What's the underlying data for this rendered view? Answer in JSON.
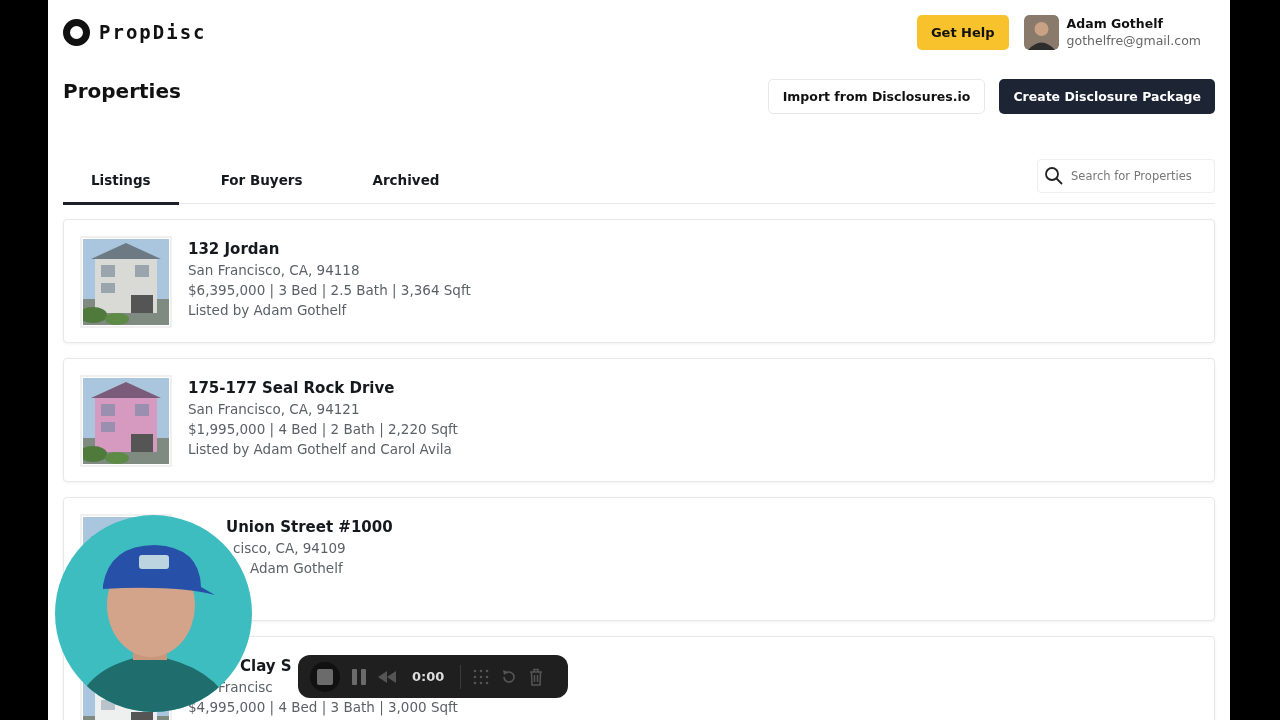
{
  "brand": {
    "name": "PropDisc"
  },
  "header": {
    "help_button": "Get Help",
    "user": {
      "name": "Adam Gothelf",
      "email": "gothelfre@gmail.com"
    }
  },
  "page": {
    "title": "Properties",
    "actions": [
      {
        "label": "Import from Disclosures.io",
        "kind": "outline"
      },
      {
        "label": "Create Disclosure Package",
        "kind": "solid"
      }
    ]
  },
  "tabs": [
    {
      "label": "Listings",
      "selected": true
    },
    {
      "label": "For Buyers",
      "selected": false
    },
    {
      "label": "Archived",
      "selected": false
    }
  ],
  "search": {
    "placeholder": "Search for Properties"
  },
  "listings": [
    {
      "kind": "full",
      "title": "132 Jordan",
      "address": "San Francisco, CA, 94118",
      "details": "$6,395,000 | 3 Bed | 2.5 Bath | 3,364 Sqft",
      "listed_by": "Listed by Adam Gothelf"
    },
    {
      "kind": "full",
      "title": "175-177 Seal Rock Drive",
      "address": "San Francisco, CA, 94121",
      "details": "$1,995,000 | 4 Bed | 2 Bath | 2,220 Sqft",
      "listed_by": "Listed by Adam Gothelf and Carol Avila"
    },
    {
      "kind": "covered",
      "title": "Union Street #1000",
      "address": "cisco, CA, 94109",
      "listed_by": "Adam Gothelf"
    },
    {
      "kind": "covered",
      "title": "Clay S",
      "address": "Francisc",
      "details": "$4,995,000 | 4 Bed | 3 Bath | 3,000 Sqft"
    }
  ],
  "recorder": {
    "time": "0:00"
  }
}
